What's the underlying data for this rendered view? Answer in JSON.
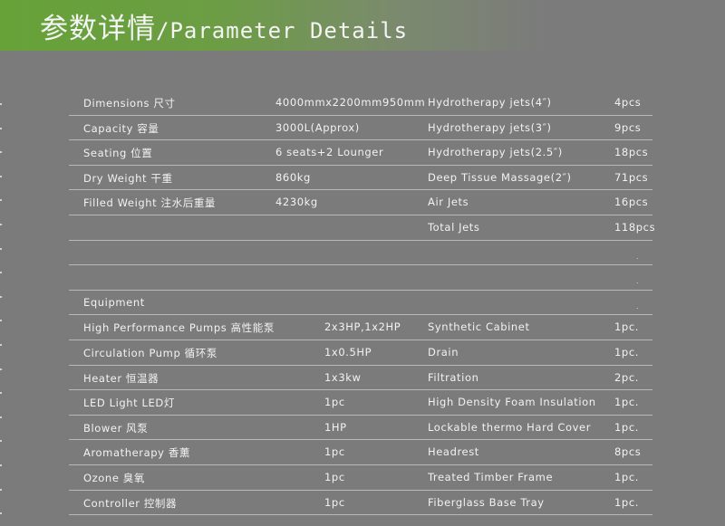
{
  "header": {
    "title_cn": "参数详情",
    "title_en": "/Parameter Details"
  },
  "specs": [
    [
      "Dimensions 尺寸",
      "4000mmx2200mm950mm",
      "Hydrotherapy jets(4″)",
      "4pcs"
    ],
    [
      "Capacity 容量",
      "3000L(Approx)",
      "Hydrotherapy jets(3″)",
      "9pcs"
    ],
    [
      "Seating 位置",
      "6 seats+2 Lounger",
      "Hydrotherapy jets(2.5″)",
      "18pcs"
    ],
    [
      "Dry Weight 干重",
      "860kg",
      "Deep Tissue Massage(2″)",
      "71pcs"
    ],
    [
      "Filled Weight 注水后重量",
      "4230kg",
      "Air Jets",
      "16pcs"
    ]
  ],
  "total": {
    "label": "Total Jets",
    "value": "118pcs"
  },
  "equipment_heading": "Equipment",
  "equipment": [
    [
      "High Performance Pumps 高性能泵",
      "2x3HP,1x2HP",
      "Synthetic Cabinet",
      "1pc."
    ],
    [
      "Circulation Pump 循环泵",
      "1x0.5HP",
      "Drain",
      "1pc."
    ],
    [
      "Heater 恒温器",
      "1x3kw",
      "Filtration",
      "2pc."
    ],
    [
      "LED Light LED灯",
      "1pc",
      "High Density Foam Insulation",
      "1pc."
    ],
    [
      "Blower 风泵",
      "1HP",
      "Lockable thermo Hard Cover",
      "1pc."
    ],
    [
      "Aromatherapy 香薰",
      "1pc",
      "Headrest",
      "8pcs"
    ],
    [
      "Ozone 臭氧",
      "1pc",
      "Treated Timber Frame",
      "1pc."
    ],
    [
      "Controller 控制器",
      "1pc",
      "Fiberglass Base Tray",
      "1pc."
    ]
  ]
}
